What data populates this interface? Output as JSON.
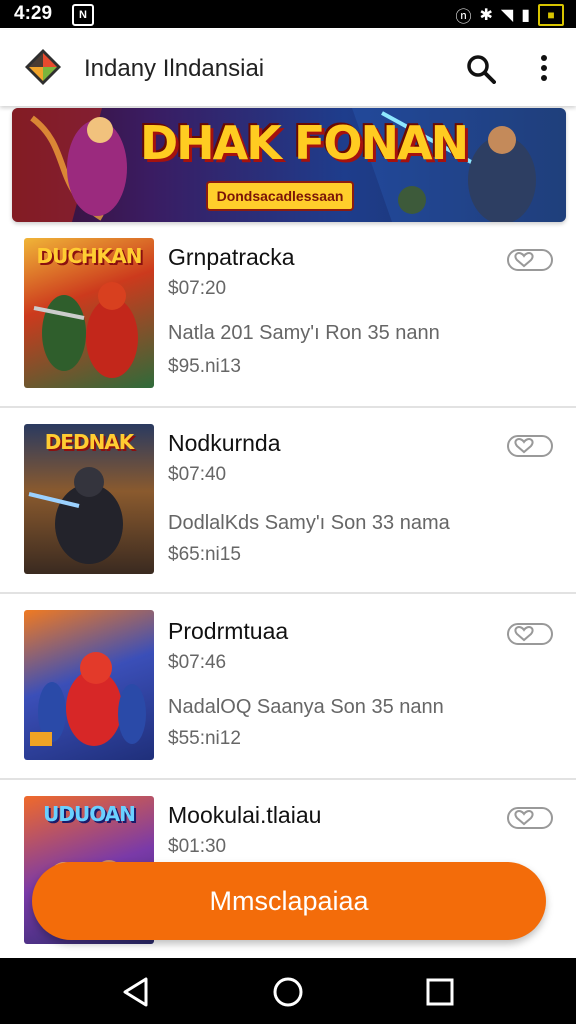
{
  "status": {
    "time": "4:29",
    "left_icon": "N"
  },
  "app": {
    "title": "Indany Ilndansiai"
  },
  "banner": {
    "title": "DHAK FONAN",
    "subtitle": "Dondsacadlessaan"
  },
  "products": [
    {
      "name": "Grnpatracka",
      "price": "$07:20",
      "desc": "Natla 201 Samy'ı Ron 35 nann",
      "sub": "$95.ni13",
      "thumb_label": "DUCHKAN"
    },
    {
      "name": "Nodkurnda",
      "price": "$07:40",
      "desc": "DodlalKds Samy'ı Son 33 nama",
      "sub": "$65:ni15",
      "thumb_label": "DEDNAK"
    },
    {
      "name": "Prodrmtuaa",
      "price": "$07:46",
      "desc": "NadalOQ Saanya Son 35 nann",
      "sub": "$55:ni12",
      "thumb_label": ""
    },
    {
      "name": "Mookulai.tlaiau",
      "price": "$01:30",
      "desc": "",
      "sub": "",
      "thumb_label": "UDUOAN"
    }
  ],
  "cta": {
    "label": "Mmsclapaiaa"
  },
  "colors": {
    "accent": "#f36c0a",
    "banner_text": "#ffcc21"
  },
  "icons": [
    "app-logo-icon",
    "search-icon",
    "more-vert-icon",
    "heart-outline-icon",
    "back-icon",
    "home-icon",
    "recents-icon"
  ]
}
